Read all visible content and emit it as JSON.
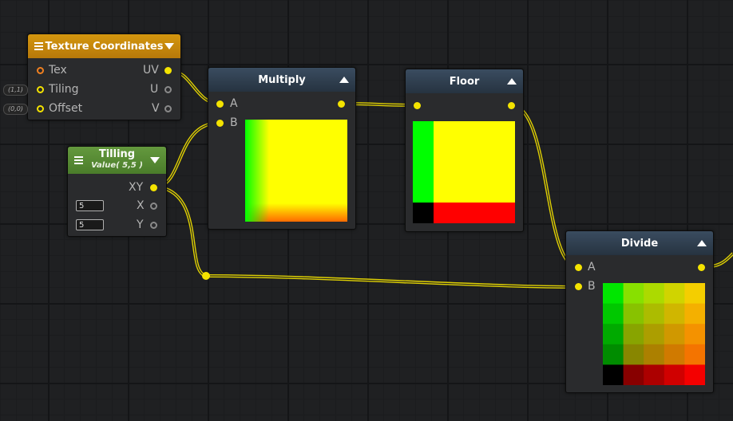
{
  "nodes": {
    "texcoords": {
      "title": "Texture Coordinates",
      "inputs": [
        "Tex",
        "Tiling",
        "Offset"
      ],
      "outputs": [
        "UV",
        "U",
        "V"
      ],
      "tiling_default": "(1,1)",
      "offset_default": "(0,0)"
    },
    "tilling": {
      "title": "Tilling",
      "subtitle": "Value( 5,5 )",
      "output": "XY",
      "rows": [
        {
          "value": "5",
          "label": "X"
        },
        {
          "value": "5",
          "label": "Y"
        }
      ]
    },
    "multiply": {
      "title": "Multiply",
      "inputs": [
        "A",
        "B"
      ]
    },
    "floor": {
      "title": "Floor"
    },
    "divide": {
      "title": "Divide",
      "inputs": [
        "A",
        "B"
      ]
    }
  },
  "colors": {
    "header_blue": "#2f3f50",
    "header_orange": "#c78a0c",
    "header_green": "#578a34",
    "wire": "#f4e300",
    "port": "#f4e300"
  },
  "icons": [
    "menu-icon",
    "collapse-triangle-icon",
    "expand-triangle-icon"
  ]
}
